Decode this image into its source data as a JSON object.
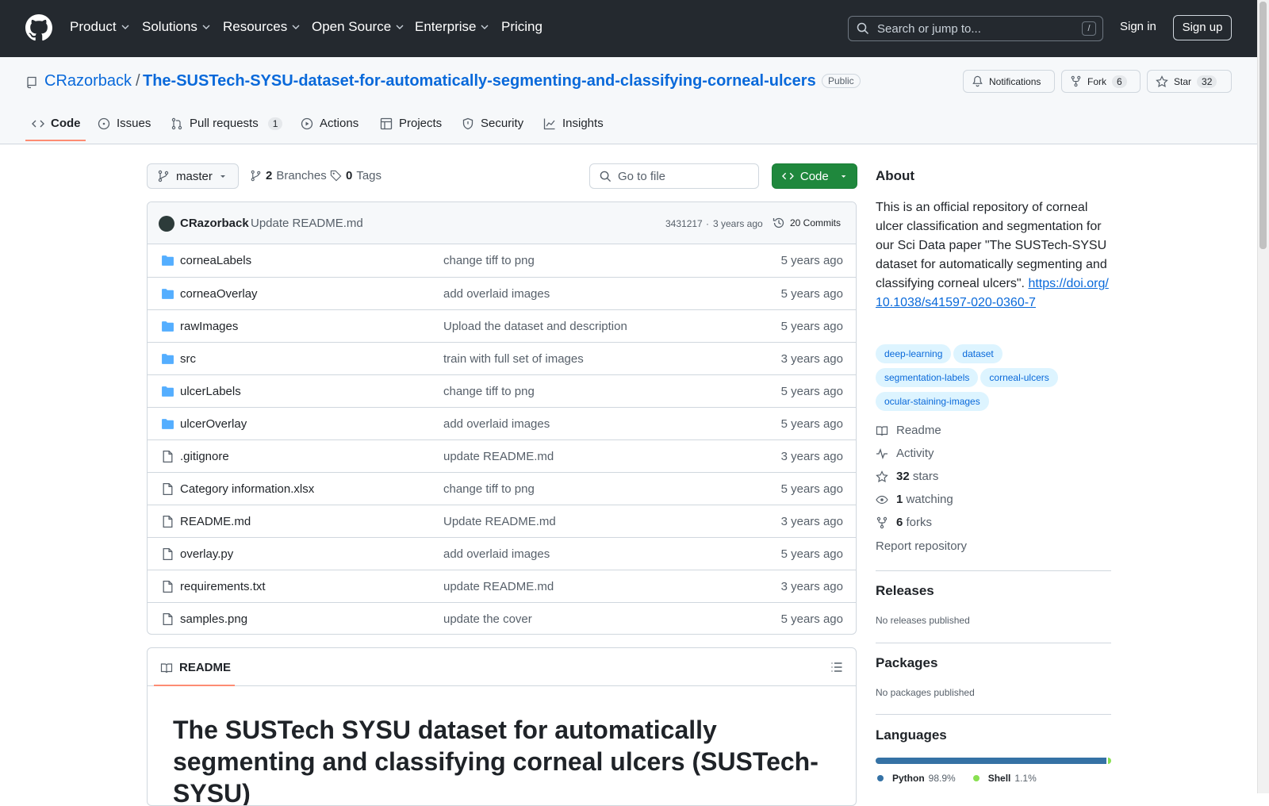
{
  "nav": {
    "items": [
      {
        "label": "Product",
        "chevron": true
      },
      {
        "label": "Solutions",
        "chevron": true
      },
      {
        "label": "Resources",
        "chevron": true
      },
      {
        "label": "Open Source",
        "chevron": true
      },
      {
        "label": "Enterprise",
        "chevron": true
      },
      {
        "label": "Pricing",
        "chevron": false
      }
    ],
    "search_placeholder": "Search or jump to...",
    "search_key": "/",
    "signin": "Sign in",
    "signup": "Sign up"
  },
  "repo": {
    "owner": "CRazorback",
    "name": "The-SUSTech-SYSU-dataset-for-automatically-segmenting-and-classifying-corneal-ulcers",
    "visibility": "Public",
    "notifications": "Notifications",
    "fork_label": "Fork",
    "fork_count": "6",
    "star_label": "Star",
    "star_count": "32"
  },
  "tabs": [
    {
      "label": "Code",
      "icon": "code-icon"
    },
    {
      "label": "Issues",
      "icon": "issue-icon"
    },
    {
      "label": "Pull requests",
      "icon": "pr-icon",
      "count": "1"
    },
    {
      "label": "Actions",
      "icon": "play-icon"
    },
    {
      "label": "Projects",
      "icon": "table-icon"
    },
    {
      "label": "Security",
      "icon": "shield-icon"
    },
    {
      "label": "Insights",
      "icon": "graph-icon"
    }
  ],
  "toolbar": {
    "branch": "master",
    "branches_count": "2",
    "branches_label": "Branches",
    "tags_count": "0",
    "tags_label": "Tags",
    "goto_placeholder": "Go to file",
    "code_button": "Code"
  },
  "commit": {
    "author": "CRazorback",
    "message": "Update README.md",
    "hash": "3431217",
    "age": "3 years ago",
    "commits": "20 Commits"
  },
  "files": [
    {
      "type": "dir",
      "name": "corneaLabels",
      "message": "change tiff to png",
      "age": "5 years ago"
    },
    {
      "type": "dir",
      "name": "corneaOverlay",
      "message": "add overlaid images",
      "age": "5 years ago"
    },
    {
      "type": "dir",
      "name": "rawImages",
      "message": "Upload the dataset and description",
      "age": "5 years ago"
    },
    {
      "type": "dir",
      "name": "src",
      "message": "train with full set of images",
      "age": "3 years ago"
    },
    {
      "type": "dir",
      "name": "ulcerLabels",
      "message": "change tiff to png",
      "age": "5 years ago"
    },
    {
      "type": "dir",
      "name": "ulcerOverlay",
      "message": "add overlaid images",
      "age": "5 years ago"
    },
    {
      "type": "file",
      "name": ".gitignore",
      "message": "update README.md",
      "age": "3 years ago"
    },
    {
      "type": "file",
      "name": "Category information.xlsx",
      "message": "change tiff to png",
      "age": "5 years ago"
    },
    {
      "type": "file",
      "name": "README.md",
      "message": "Update README.md",
      "age": "3 years ago"
    },
    {
      "type": "file",
      "name": "overlay.py",
      "message": "add overlaid images",
      "age": "5 years ago"
    },
    {
      "type": "file",
      "name": "requirements.txt",
      "message": "update README.md",
      "age": "3 years ago"
    },
    {
      "type": "file",
      "name": "samples.png",
      "message": "update the cover",
      "age": "5 years ago"
    }
  ],
  "readme": {
    "tab": "README",
    "title": "The SUSTech SYSU dataset for automatically segmenting and classifying corneal ulcers (SUSTech-SYSU)"
  },
  "about": {
    "heading": "About",
    "description": "This is an official repository of corneal ulcer classification and segmentation for our Sci Data paper \"The SUSTech-SYSU dataset for automatically segmenting and classifying corneal ulcers\".",
    "link": "https://doi.org/10.1038/s41597-020-0360-7",
    "topics": [
      "deep-learning",
      "dataset",
      "segmentation-labels",
      "corneal-ulcers",
      "ocular-staining-images"
    ],
    "readme": "Readme",
    "activity": "Activity",
    "stars_count": "32",
    "stars_label": "stars",
    "watching_count": "1",
    "watching_label": "watching",
    "forks_count": "6",
    "forks_label": "forks",
    "report": "Report repository"
  },
  "releases": {
    "heading": "Releases",
    "text": "No releases published"
  },
  "packages": {
    "heading": "Packages",
    "text": "No packages published"
  },
  "languages": {
    "heading": "Languages",
    "items": [
      {
        "name": "Python",
        "percent": "98.9%",
        "value": 98.9,
        "color": "#3572A5"
      },
      {
        "name": "Shell",
        "percent": "1.1%",
        "value": 1.1,
        "color": "#89e051"
      }
    ]
  }
}
